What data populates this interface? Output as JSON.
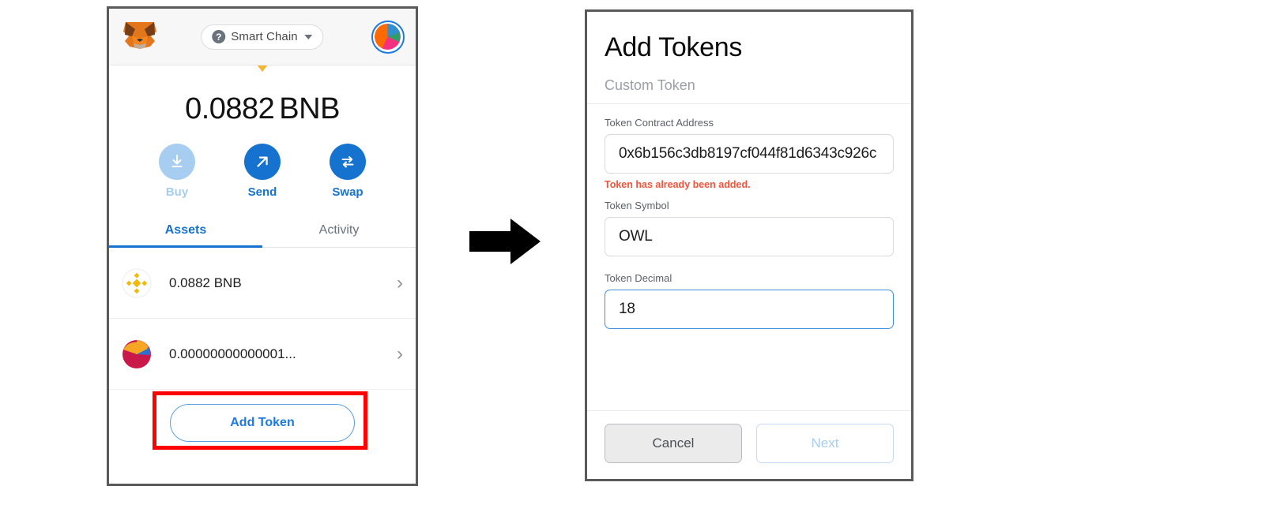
{
  "wallet": {
    "header": {
      "fox_icon": "metamask-fox-logo",
      "network": {
        "label": "Smart Chain",
        "help_icon": "question-mark-icon",
        "chevron_icon": "chevron-down-icon"
      },
      "avatar": "account-avatar"
    },
    "balance": {
      "amount": "0.0882",
      "unit": "BNB"
    },
    "actions": [
      {
        "label": "Buy",
        "icon": "download-arrow-icon",
        "enabled": false
      },
      {
        "label": "Send",
        "icon": "arrow-up-right-icon",
        "enabled": true
      },
      {
        "label": "Swap",
        "icon": "swap-arrows-icon",
        "enabled": true
      }
    ],
    "tabs": [
      {
        "label": "Assets",
        "active": true
      },
      {
        "label": "Activity",
        "active": false
      }
    ],
    "assets": [
      {
        "amount": "0.0882 BNB",
        "icon": "bnb-token-icon",
        "chevron": "›"
      },
      {
        "amount": "0.00000000000001...",
        "icon": "owl-token-icon",
        "chevron": "›"
      }
    ],
    "add_token_button": "Add Token",
    "highlight_color": "#fd0000"
  },
  "arrow": {
    "icon": "right-arrow-icon"
  },
  "dialog": {
    "title": "Add Tokens",
    "tab": "Custom Token",
    "fields": [
      {
        "label": "Token Contract Address",
        "value": "0x6b156c3db8197cf044f81d6343c926c",
        "error": "Token has already been added.",
        "focused": false
      },
      {
        "label": "Token Symbol",
        "value": "OWL",
        "error": "",
        "focused": false
      },
      {
        "label": "Token Decimal",
        "value": "18",
        "error": "",
        "focused": true
      }
    ],
    "buttons": {
      "cancel": "Cancel",
      "next": "Next"
    },
    "error_color": "#f4543c",
    "focus_color": "#3f8fe0"
  }
}
